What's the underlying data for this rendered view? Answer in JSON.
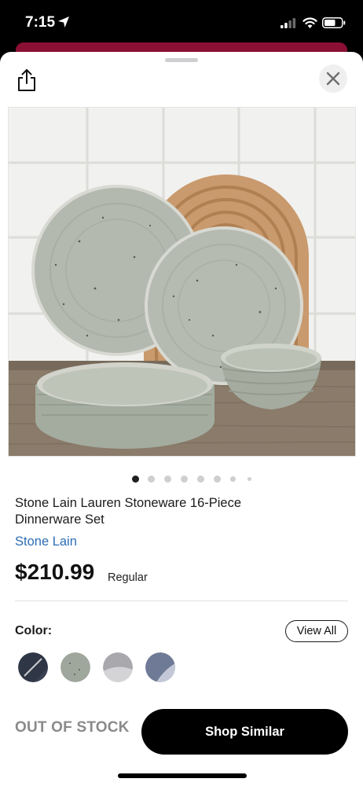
{
  "status_bar": {
    "time": "7:15",
    "icons": [
      "location-arrow-icon",
      "cellular-signal-icon",
      "wifi-icon",
      "battery-icon"
    ]
  },
  "header": {
    "icons": [
      "share-icon",
      "close-icon"
    ]
  },
  "gallery": {
    "image_count": 8,
    "active_index": 0
  },
  "product": {
    "title": "Stone Lain Lauren Stoneware 16-Piece Dinnerware Set",
    "brand": "Stone Lain",
    "price": "$210.99",
    "price_label": "Regular"
  },
  "color": {
    "label": "Color:",
    "view_all": "View All",
    "swatch_colors": [
      "#2f3645",
      "#9fa69b",
      "#a9a9ad",
      "#6f7a96"
    ]
  },
  "actions": {
    "stock_status": "OUT OF STOCK",
    "shop_similar": "Shop Similar"
  },
  "colors": {
    "accent": "#8b1034",
    "link": "#2c6db5"
  }
}
